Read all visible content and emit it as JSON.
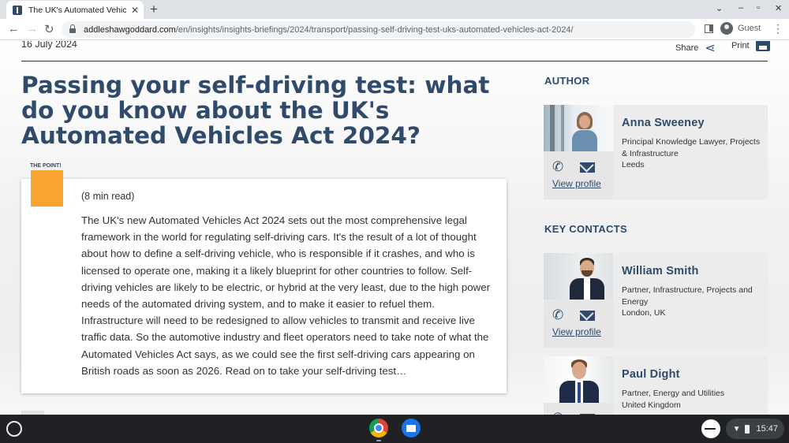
{
  "browser": {
    "tab_title": "The UK's Automated Vehicles Act",
    "tab_close": "✕",
    "new_tab": "+",
    "url_domain": "addleshawgoddard.com",
    "url_path": "/en/insights/insights-briefings/2024/transport/passing-self-driving-test-uks-automated-vehicles-act-2024/",
    "profile_label": "Guest",
    "icons": {
      "back": "arrow-left-icon",
      "forward": "arrow-right-icon",
      "reload": "reload-icon",
      "lock": "lock-icon",
      "menu": "kebab-menu-icon"
    }
  },
  "article": {
    "date": "16 July 2024",
    "share_label": "Share",
    "print_label": "Print",
    "title": "Passing your self-driving test: what do you know about the UK's Automated Vehicles Act 2024?",
    "point_label": "THE POINT!",
    "read_time": "(8 min read)",
    "body": "The UK's new Automated Vehicles Act 2024 sets out the most comprehensive legal framework in the world for regulating self-driving cars. It's the result of a lot of thought about how to define a self-driving vehicle, who is responsible if it crashes, and who is licensed to operate one, making it a likely blueprint for other countries to follow. Self-driving vehicles are likely to be electric, or hybrid at the very least, due to the high power needs of the automated driving system, and to make it easier to refuel them. Infrastructure will need to be redesigned to allow vehicles to transmit and receive live traffic data. So the automotive industry and fleet operators need to take note of what the Automated Vehicles Act says, as we could see the first self-driving cars appearing on British roads as soon as 2026. Read on to take your self-driving test…"
  },
  "sidebar": {
    "author_heading": "AUTHOR",
    "key_contacts_heading": "KEY CONTACTS",
    "view_profile_label": "View profile",
    "author": {
      "name": "Anna Sweeney",
      "role": "Principal Knowledge Lawyer, Projects & Infrastructure",
      "location": "Leeds"
    },
    "contacts": [
      {
        "name": "William Smith",
        "role": "Partner, Infrastructure, Projects and Energy",
        "location": "London, UK"
      },
      {
        "name": "Paul Dight",
        "role": "Partner, Energy and Utilities",
        "location": "United Kingdom"
      }
    ]
  },
  "shelf": {
    "time": "15:47",
    "apps": [
      "chrome-icon",
      "files-icon"
    ]
  },
  "colors": {
    "brand": "#2f4a6b",
    "accent": "#f9a533"
  }
}
